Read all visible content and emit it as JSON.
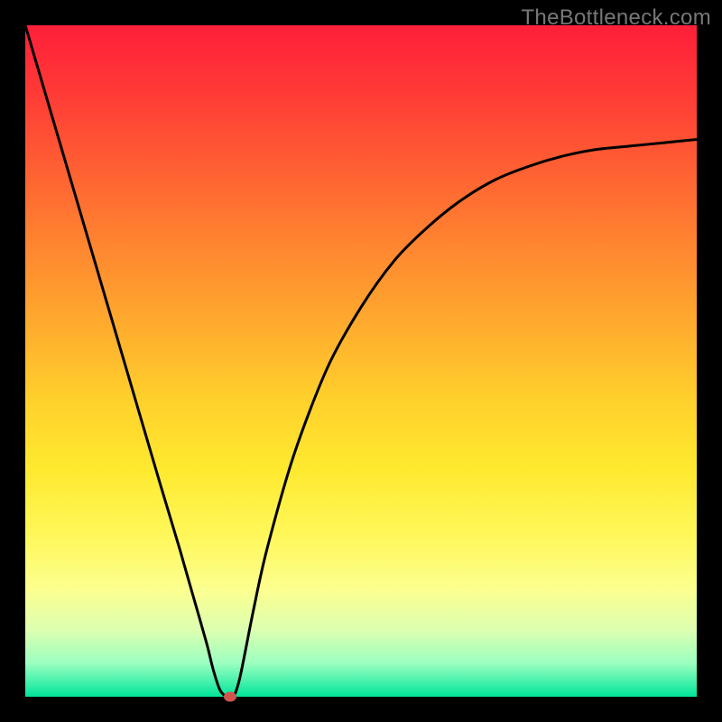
{
  "watermark": "TheBottleneck.com",
  "chart_data": {
    "type": "line",
    "title": "",
    "xlabel": "",
    "ylabel": "",
    "xlim": [
      0,
      100
    ],
    "ylim": [
      0,
      100
    ],
    "x": [
      0,
      5,
      10,
      15,
      20,
      23,
      25,
      27,
      28,
      29,
      30,
      31,
      32,
      34,
      36,
      40,
      45,
      50,
      55,
      60,
      65,
      70,
      75,
      80,
      85,
      90,
      95,
      100
    ],
    "y": [
      100,
      83,
      66,
      49,
      32,
      22,
      15,
      8,
      4,
      1,
      0,
      0,
      3,
      13,
      22,
      36,
      49,
      58,
      65,
      70,
      74,
      77,
      79,
      80.5,
      81.5,
      82,
      82.5,
      83
    ],
    "marker": {
      "x": 30.5,
      "y": 0
    },
    "colors": {
      "line": "#000000",
      "marker": "#d0544e",
      "gradient_top": "#ff1f3a",
      "gradient_bottom": "#00e59a"
    }
  }
}
